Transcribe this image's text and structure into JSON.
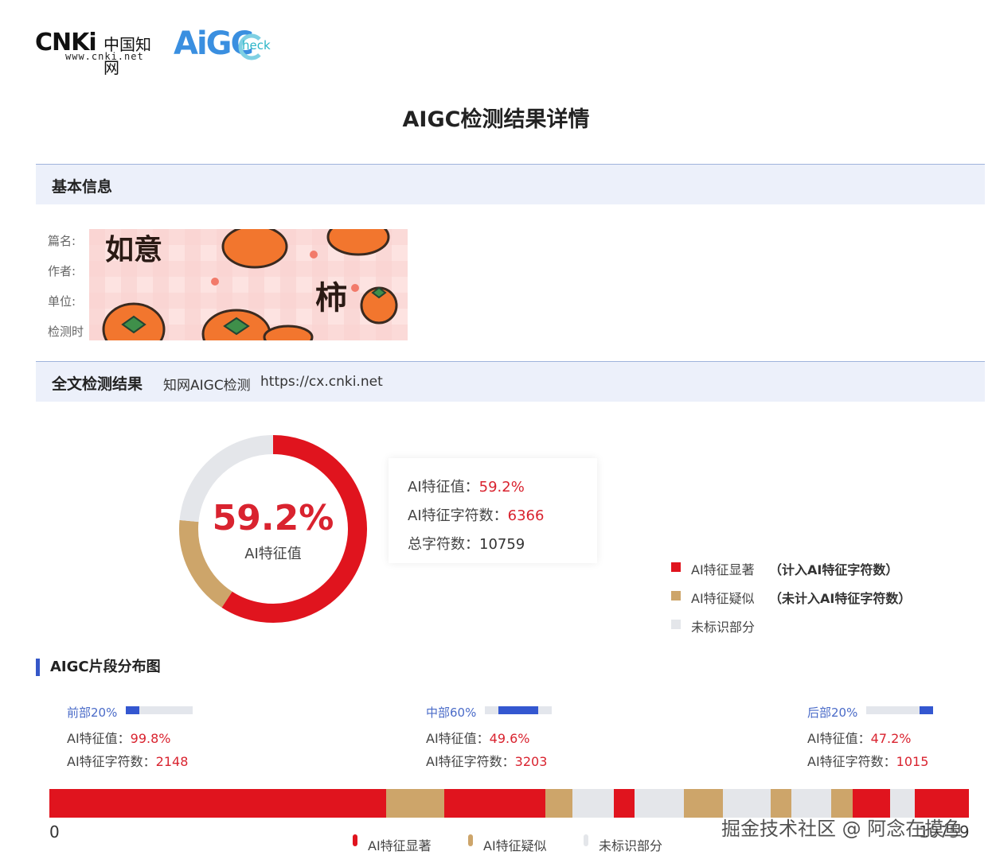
{
  "header": {
    "cnki_logo_main": "CNKi",
    "cnki_logo_cn": "中国知网",
    "cnki_logo_url": "www.cnki.net",
    "aigc_logo_main": "AiGC",
    "aigc_logo_sub": "heck"
  },
  "page_title": "AIGC检测结果详情",
  "basic_info": {
    "section_title": "基本信息",
    "labels": [
      "篇名:",
      "作者:",
      "单位:",
      "检测时"
    ]
  },
  "photo_overlay": {
    "text_top": "如意",
    "text_right": "柿"
  },
  "fulltext": {
    "section_title": "全文检测结果",
    "source": "知网AIGC检测",
    "url": "https://cx.cnki.net"
  },
  "summary": {
    "center_value": "59.2%",
    "center_label": "AI特征值",
    "ai_value_label": "AI特征值：",
    "ai_value": "59.2%",
    "ai_chars_label": "AI特征字符数：",
    "ai_chars": "6366",
    "total_chars_label": "总字符数：",
    "total_chars": "10759"
  },
  "legend": [
    {
      "label": "AI特征显著",
      "note": "（计入AI特征字符数）",
      "color": "#e0141e"
    },
    {
      "label": "AI特征疑似",
      "note": "（未计入AI特征字符数）",
      "color": "#cda56a"
    },
    {
      "label": "未标识部分",
      "note": "",
      "color": "#e4e6ea"
    }
  ],
  "distribution": {
    "title": "AIGC片段分布图",
    "segments": [
      {
        "head": "前部20%",
        "value_label": "AI特征值：",
        "value": "99.8%",
        "chars_label": "AI特征字符数：",
        "chars": "2148",
        "bar_from": 0.0,
        "bar_to": 0.2
      },
      {
        "head": "中部60%",
        "value_label": "AI特征值：",
        "value": "49.6%",
        "chars_label": "AI特征字符数：",
        "chars": "3203",
        "bar_from": 0.2,
        "bar_to": 0.8
      },
      {
        "head": "后部20%",
        "value_label": "AI特征值：",
        "value": "47.2%",
        "chars_label": "AI特征字符数：",
        "chars": "1015",
        "bar_from": 0.8,
        "bar_to": 1.0
      }
    ],
    "axis_start": "0",
    "axis_end": "10759",
    "bottom_legend": [
      "AI特征显著",
      "AI特征疑似",
      "未标识部分"
    ]
  },
  "chart_data": {
    "type": "pie",
    "categories": [
      "AI特征显著",
      "AI特征疑似",
      "未标识部分"
    ],
    "values": [
      59.2,
      17.3,
      23.5
    ],
    "colors": [
      "#e0141e",
      "#cda56a",
      "#e4e6ea"
    ],
    "strip": {
      "total": 10759,
      "segments": [
        {
          "type": "显著",
          "from": 0,
          "to": 3940
        },
        {
          "type": "疑似",
          "from": 3940,
          "to": 4620
        },
        {
          "type": "显著",
          "from": 4620,
          "to": 5800
        },
        {
          "type": "疑似",
          "from": 5800,
          "to": 6120
        },
        {
          "type": "未标识",
          "from": 6120,
          "to": 6600
        },
        {
          "type": "显著",
          "from": 6600,
          "to": 6850
        },
        {
          "type": "未标识",
          "from": 6850,
          "to": 7420
        },
        {
          "type": "疑似",
          "from": 7420,
          "to": 7880
        },
        {
          "type": "未标识",
          "from": 7880,
          "to": 8440
        },
        {
          "type": "疑似",
          "from": 8440,
          "to": 8680
        },
        {
          "type": "未标识",
          "from": 8680,
          "to": 9150
        },
        {
          "type": "疑似",
          "from": 9150,
          "to": 9400
        },
        {
          "type": "显著",
          "from": 9400,
          "to": 9840
        },
        {
          "type": "未标识",
          "from": 9840,
          "to": 10130
        },
        {
          "type": "显著",
          "from": 10130,
          "to": 10759
        }
      ]
    }
  },
  "watermark": "掘金技术社区 @ 阿念在摸鱼"
}
